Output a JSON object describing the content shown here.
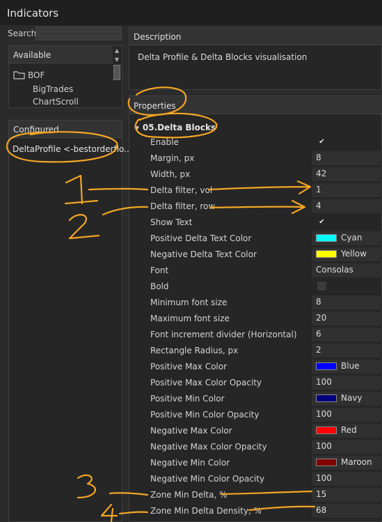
{
  "window": {
    "title": "Indicators"
  },
  "search": {
    "label": "Search",
    "value": ""
  },
  "available": {
    "header": "Available",
    "items": [
      {
        "label": "BOF",
        "icon": "folder-icon"
      },
      {
        "label": "BigTrades"
      },
      {
        "label": "ChartScroll"
      }
    ]
  },
  "configured": {
    "header": "Configured",
    "items": [
      {
        "label": "DeltaProfile <-bestorderflo..."
      }
    ]
  },
  "description": {
    "header": "Description",
    "text": "Delta Profile & Delta Blocks visualisation"
  },
  "properties": {
    "header": "Properties",
    "group": "05.Delta Blocks",
    "rows": [
      {
        "name": "Enable",
        "type": "check",
        "checked": true
      },
      {
        "name": "Margin, px",
        "type": "text",
        "value": "8"
      },
      {
        "name": "Width, px",
        "type": "text",
        "value": "42"
      },
      {
        "name": "Delta filter, vol",
        "type": "text",
        "value": "1"
      },
      {
        "name": "Delta filter, row",
        "type": "text",
        "value": "4"
      },
      {
        "name": "Show Text",
        "type": "check",
        "checked": true
      },
      {
        "name": "Positive Delta Text Color",
        "type": "color",
        "color": "#00ffff",
        "value": "Cyan"
      },
      {
        "name": "Negative Delta Text Color",
        "type": "color",
        "color": "#ffff00",
        "value": "Yellow"
      },
      {
        "name": "Font",
        "type": "text",
        "value": "Consolas"
      },
      {
        "name": "Bold",
        "type": "check",
        "checked": false
      },
      {
        "name": "Minimum font size",
        "type": "text",
        "value": "8"
      },
      {
        "name": "Maximum font size",
        "type": "text",
        "value": "20"
      },
      {
        "name": "Font increment divider (Horizontal)",
        "type": "text",
        "value": "6"
      },
      {
        "name": "Rectangle Radius, px",
        "type": "text",
        "value": "2"
      },
      {
        "name": "Positive Max Color",
        "type": "color",
        "color": "#0000ff",
        "value": "Blue"
      },
      {
        "name": "Positive Max Color Opacity",
        "type": "text",
        "value": "100"
      },
      {
        "name": "Positive Min Color",
        "type": "color",
        "color": "#000080",
        "value": "Navy"
      },
      {
        "name": "Positive Min Color Opacity",
        "type": "text",
        "value": "100"
      },
      {
        "name": "Negative Max Color",
        "type": "color",
        "color": "#ff0000",
        "value": "Red"
      },
      {
        "name": "Negative Max Color Opacity",
        "type": "text",
        "value": "100"
      },
      {
        "name": "Negative Min Color",
        "type": "color",
        "color": "#800000",
        "value": "Maroon"
      },
      {
        "name": "Negative Min Color Opacity",
        "type": "text",
        "value": "100"
      },
      {
        "name": "Zone Min Delta, %",
        "type": "text",
        "value": "15"
      },
      {
        "name": "Zone Min Delta Density, %",
        "type": "text",
        "value": "68"
      }
    ]
  },
  "annotations": {
    "color": "#f5a623",
    "numbers": [
      "1",
      "2",
      "3",
      "4"
    ]
  }
}
